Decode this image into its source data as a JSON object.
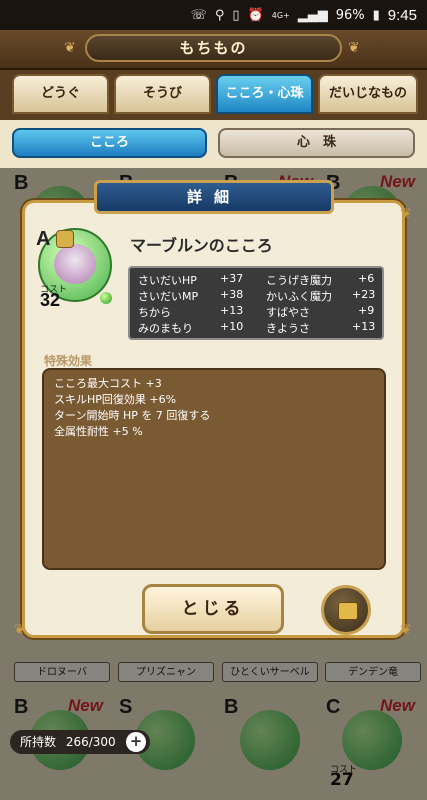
{
  "status": {
    "battery": "96%",
    "time": "9:45",
    "network": "4G+"
  },
  "header": {
    "title": "もちもの"
  },
  "tabs": [
    {
      "label": "どうぐ"
    },
    {
      "label": "そうび"
    },
    {
      "label": "こころ・心珠",
      "active": true
    },
    {
      "label": "だいじなもの"
    }
  ],
  "subtabs": [
    {
      "label": "こころ",
      "active": true
    },
    {
      "label": "心　珠"
    }
  ],
  "grid": {
    "top_ranks": [
      "B",
      "B",
      "B",
      "B"
    ],
    "top_new": [
      "New",
      "New"
    ],
    "labels": [
      "ドロヌーバ",
      "プリズニャン",
      "ひとくいサーベル",
      "デンデン竜"
    ],
    "bottom_ranks": [
      "B",
      "S",
      "B",
      "C"
    ],
    "bottom_new": [
      "New",
      "New"
    ],
    "bottom_cost_label": "コスト",
    "bottom_costs": [
      "27"
    ]
  },
  "inventory": {
    "label": "所持数",
    "value": "266/300",
    "plus": "+"
  },
  "dialog": {
    "title": "詳細",
    "rank": "A",
    "cost_label": "コスト",
    "cost": "32",
    "name": "マーブルンのこころ",
    "stats": [
      {
        "l1": "さいだいHP",
        "v1": "+37",
        "l2": "こうげき魔力",
        "v2": "+6"
      },
      {
        "l1": "さいだいMP",
        "v1": "+38",
        "l2": "かいふく魔力",
        "v2": "+23"
      },
      {
        "l1": "ちから",
        "v1": "+13",
        "l2": "すばやさ",
        "v2": "+9"
      },
      {
        "l1": "みのまもり",
        "v1": "+10",
        "l2": "きようさ",
        "v2": "+13"
      }
    ],
    "special_heading": "特殊効果",
    "special_lines": [
      "こころ最大コスト +3",
      "スキルHP回復効果 +6%",
      "ターン開始時 HP を 7 回復する",
      "全属性耐性 +5 %"
    ],
    "close_label": "とじる"
  }
}
